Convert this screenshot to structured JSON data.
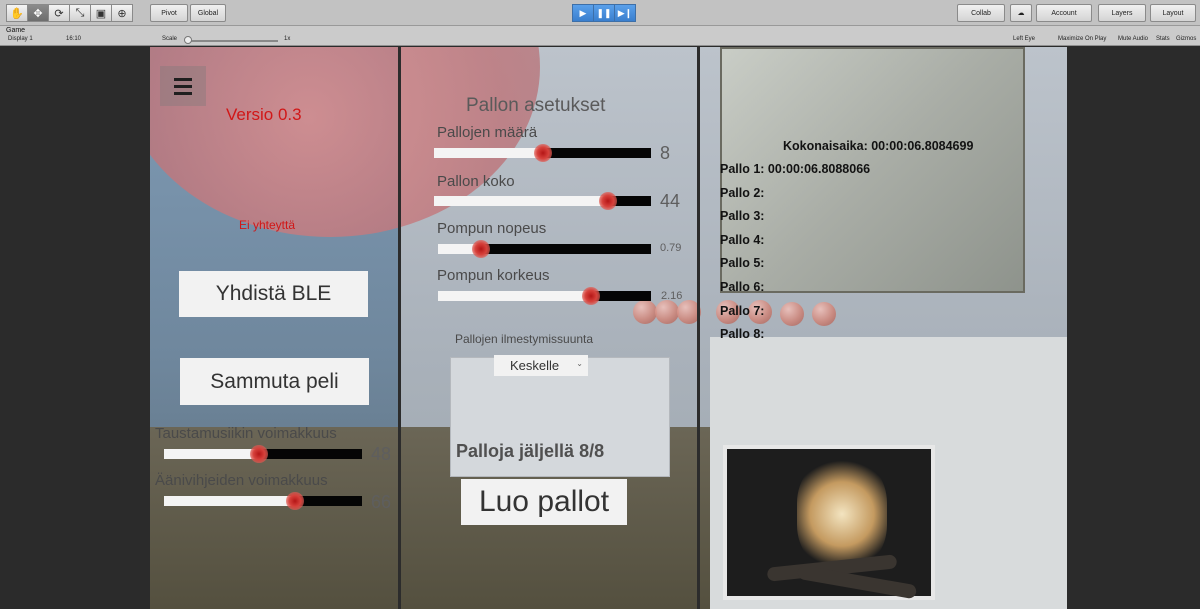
{
  "toolbar": {
    "pivot": "Pivot",
    "global": "Global",
    "collab": "Collab",
    "account": "Account",
    "layers": "Layers",
    "layout": "Layout"
  },
  "game_view": {
    "tab_title": "Game",
    "display": "Display 1",
    "aspect": "16:10",
    "scale_label": "Scale",
    "scale_value": "1x",
    "left_eye": "Left Eye",
    "maximize": "Maximize On Play",
    "mute": "Mute Audio",
    "stats": "Stats",
    "gizmos": "Gizmos"
  },
  "left_panel": {
    "version": "Versio 0.3",
    "connection_status": "Ei yhteyttä",
    "connect_ble_label": "Yhdistä BLE",
    "quit_label": "Sammuta peli",
    "music_volume_label": "Taustamusiikin voimakkuus",
    "music_volume_value": "48",
    "music_volume_level": 0.48,
    "hint_volume_label": "Äänivihjeiden voimakkuus",
    "hint_volume_value": "66",
    "hint_volume_level": 0.66
  },
  "ball_settings": {
    "title": "Pallon asetukset",
    "count_label": "Pallojen määrä",
    "count_value": "8",
    "count_level": 0.5,
    "size_label": "Pallon koko",
    "size_value": "44",
    "size_level": 0.8,
    "bounce_speed_label": "Pompun nopeus",
    "bounce_speed_value": "0.79",
    "bounce_speed_level": 0.2,
    "bounce_height_label": "Pompun korkeus",
    "bounce_height_value": "2.16",
    "bounce_height_level": 0.72,
    "spawn_direction_label": "Pallojen ilmestymissuunta",
    "spawn_direction_value": "Keskelle",
    "remaining": "Palloja jäljellä 8/8",
    "create_label": "Luo pallot"
  },
  "timers": {
    "total": "Kokonaisaika: 00:00:06.8084699",
    "balls": [
      "Pallo 1: 00:00:06.8088066",
      "Pallo 2:",
      "Pallo 3:",
      "Pallo 4:",
      "Pallo 5:",
      "Pallo 6:",
      "Pallo 7:",
      "Pallo 8:"
    ]
  },
  "colors": {
    "status_red": "#d11717",
    "handle_red": "#b41616",
    "play_blue": "#3a7fce"
  }
}
